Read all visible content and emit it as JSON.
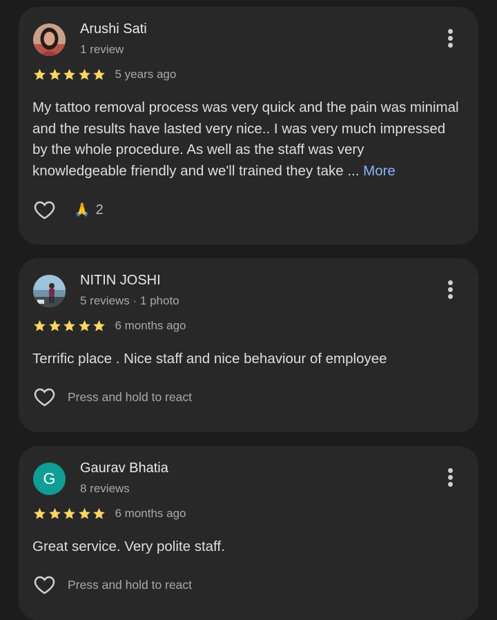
{
  "reviews": [
    {
      "name": "Arushi Sati",
      "meta": "1 review",
      "rating": 5,
      "time": "5 years ago",
      "text": "My tattoo removal process was very quick and the pain was minimal and the results have lasted very nice.. I was very much impressed by the whole procedure. As well as the staff was very knowledgeable friendly and we'll trained they take ...",
      "more_label": "More",
      "reaction": {
        "emoji": "🙏",
        "count": "2"
      },
      "avatar": "photo"
    },
    {
      "name": "NITIN JOSHI",
      "meta": "5 reviews · 1 photo",
      "rating": 5,
      "time": "6 months ago",
      "text": "Terrific place . Nice staff and nice behaviour of employee",
      "react_hint": "Press and hold to react",
      "avatar": "photo"
    },
    {
      "name": "Gaurav Bhatia",
      "meta": "8 reviews",
      "rating": 5,
      "time": "6 months ago",
      "text": "Great service. Very polite staff.",
      "react_hint": "Press and hold to react",
      "avatar": "letter",
      "avatar_letter": "G",
      "avatar_color": "#0f9d96"
    }
  ],
  "colors": {
    "background": "#1c1c1c",
    "card": "#282828",
    "star": "#fdd663",
    "link": "#8ab4f8"
  },
  "icons": [
    "profile-photo",
    "more-vert-icon",
    "star-icon",
    "heart-outline-icon",
    "folded-hands-emoji"
  ]
}
